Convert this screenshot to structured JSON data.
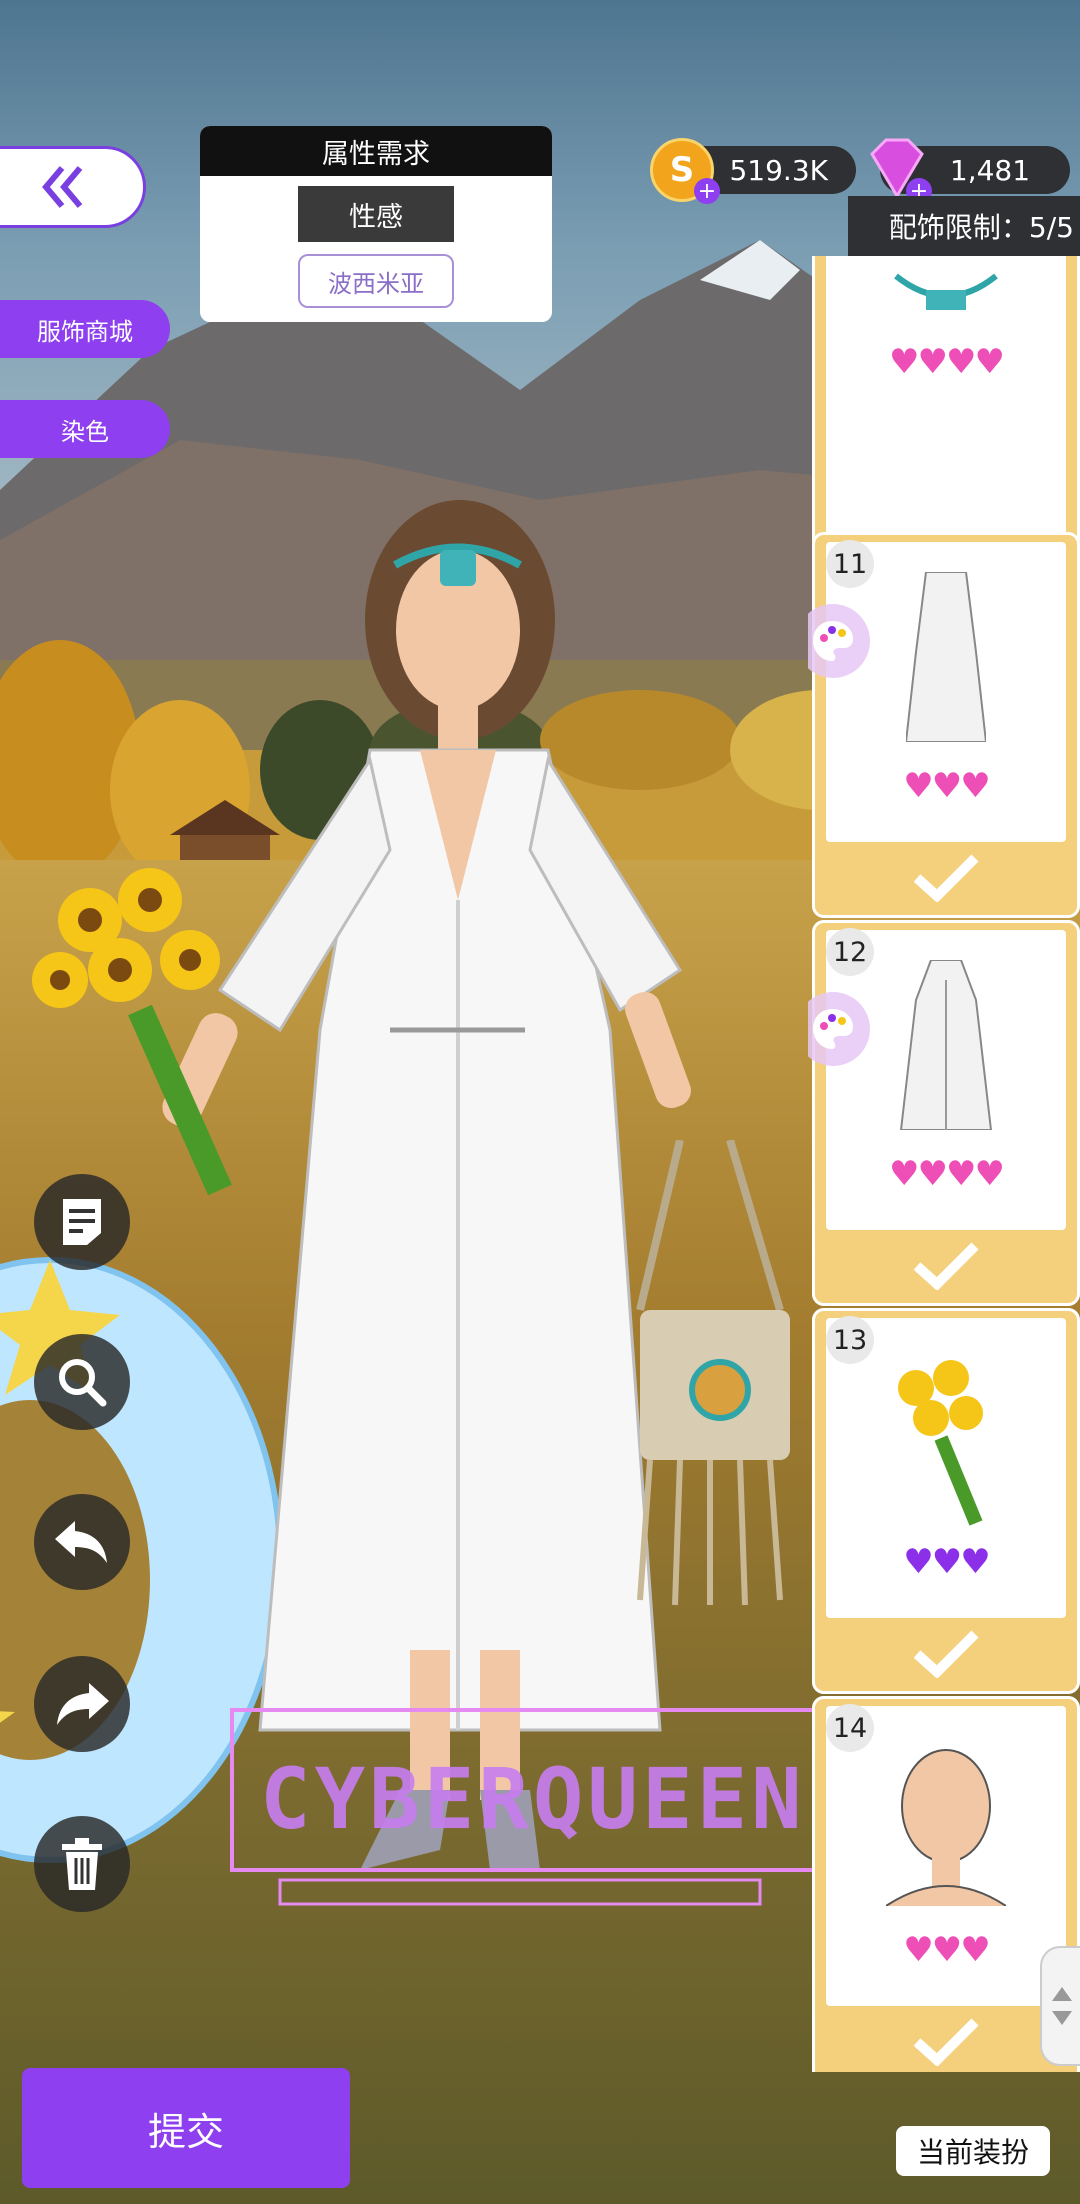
{
  "requirement": {
    "header": "属性需求",
    "tag": "性感",
    "style": "波西米亚"
  },
  "currency": {
    "coins": "519.3K",
    "gems": "1,481"
  },
  "accessory_limit": "配饰限制：5/5",
  "side_buttons": {
    "shop": "服饰商城",
    "dye": "染色"
  },
  "watermark": "CYBERQUEEN",
  "items": [
    {
      "number": "",
      "hearts": "♥♥♥♥",
      "heart_color": "#ee4fb7",
      "has_palette": false,
      "selected": true
    },
    {
      "number": "11",
      "hearts": "♥♥♥",
      "heart_color": "#ee4fb7",
      "has_palette": true,
      "selected": true
    },
    {
      "number": "12",
      "hearts": "♥♥♥♥",
      "heart_color": "#ee4fb7",
      "has_palette": true,
      "selected": true
    },
    {
      "number": "13",
      "hearts": "♥♥♥",
      "heart_color": "#8b2fe8",
      "has_palette": false,
      "selected": true
    },
    {
      "number": "14",
      "hearts": "♥♥♥",
      "heart_color": "#ee4fb7",
      "has_palette": false,
      "selected": true
    }
  ],
  "buttons": {
    "submit": "提交",
    "current_outfit": "当前装扮"
  },
  "colors": {
    "accent_purple": "#8e3ff0",
    "card_gold": "#f4cf7c",
    "heart_pink": "#ee4fb7",
    "heart_purple": "#8b2fe8"
  },
  "icons": [
    "chevrons-left-icon",
    "coin-icon",
    "gem-icon",
    "palette-icon",
    "checkmark-icon",
    "notes-icon",
    "search-icon",
    "undo-icon",
    "redo-icon",
    "trash-icon"
  ]
}
